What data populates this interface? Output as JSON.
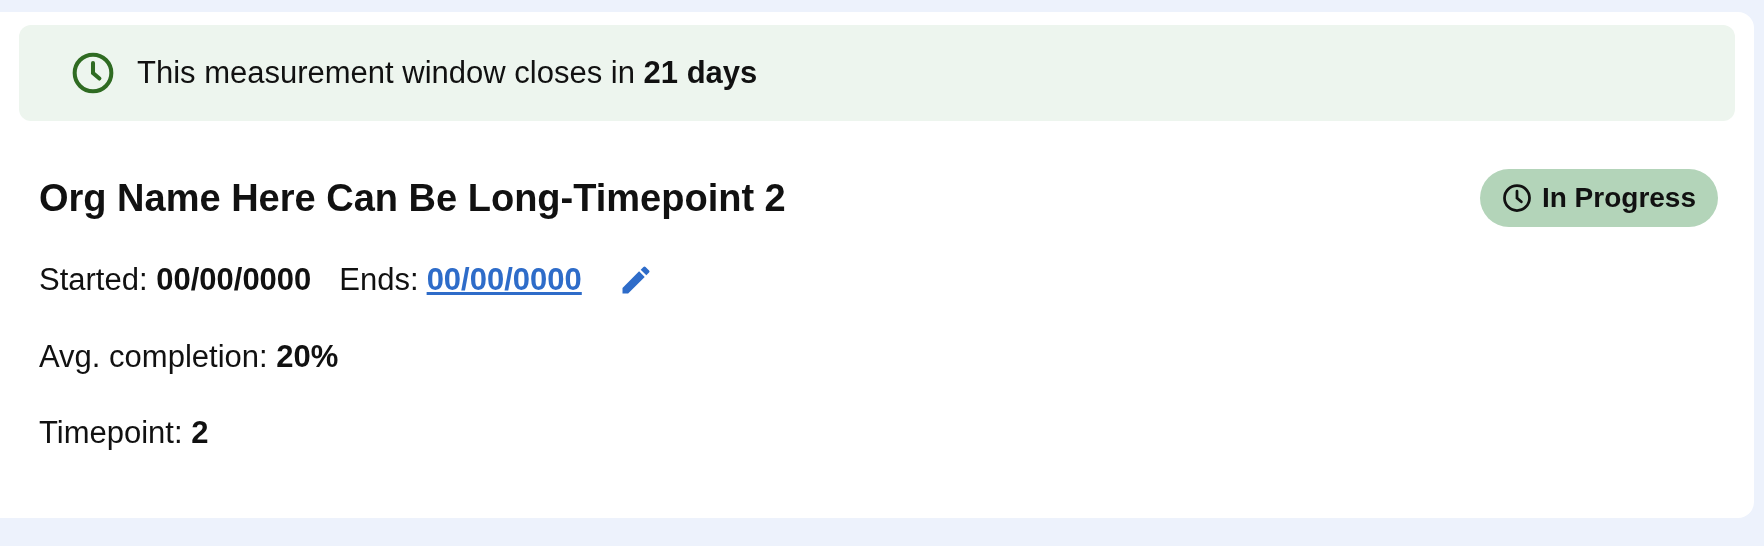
{
  "banner": {
    "text": "This measurement window closes in **21 days**"
  },
  "title": "Org Name Here Can Be Long-Timepoint 2",
  "status": {
    "label": "In Progress"
  },
  "dates": {
    "started": "Started: **00/00/0000**",
    "ends_label": "Ends:",
    "ends": "00/00/0000"
  },
  "fields": [
    "Avg. completion: **20%**",
    "Timepoint: **2**"
  ]
}
